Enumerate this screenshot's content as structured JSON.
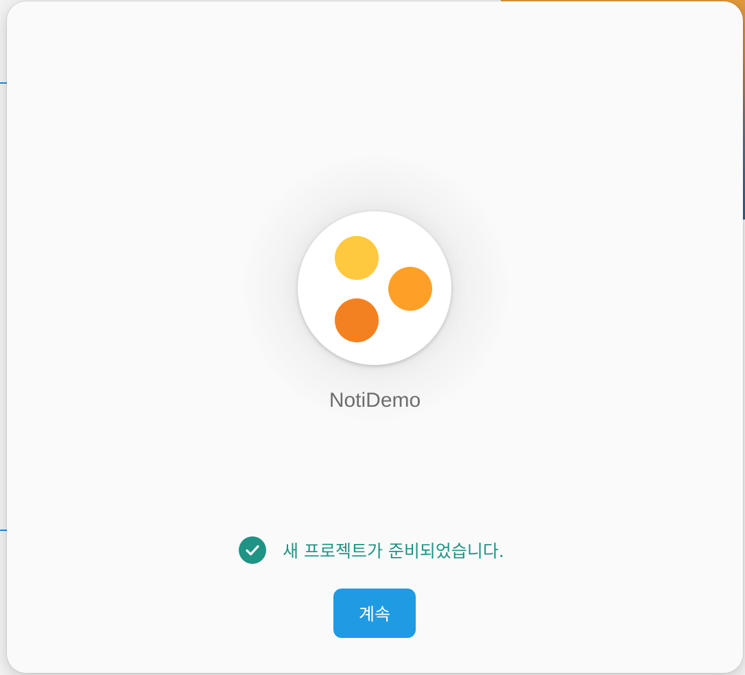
{
  "dialog": {
    "app_name": "NotiDemo",
    "status_message": "새 프로젝트가 준비되었습니다.",
    "continue_label": "계속",
    "logo_icon": "three-dots-logo-icon",
    "status_icon": "check-circle-icon"
  },
  "colors": {
    "status": "#1f9384",
    "button": "#1e9be2",
    "dot_yellow": "#fec93e",
    "dot_orange": "#fea028",
    "dot_deep_orange": "#f48120"
  }
}
